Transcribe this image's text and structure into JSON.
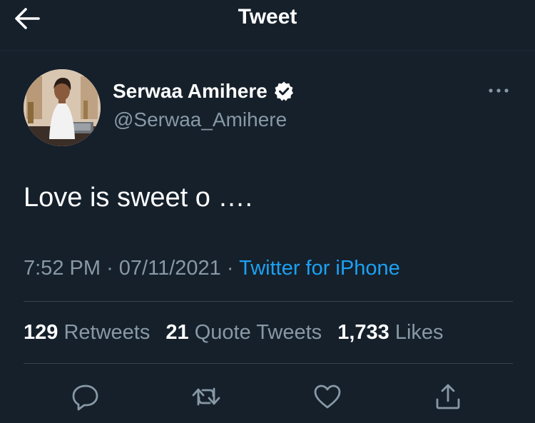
{
  "header": {
    "title": "Tweet",
    "back_icon": "arrow-left-icon"
  },
  "tweet": {
    "display_name": "Serwaa Amihere",
    "handle": "@Serwaa_Amihere",
    "verified": true,
    "text": "Love is sweet o ….",
    "time": "7:52 PM",
    "separator": "·",
    "date": "07/11/2021",
    "source": "Twitter for iPhone"
  },
  "stats": {
    "retweets_count": "129",
    "retweets_label": "Retweets",
    "quotes_count": "21",
    "quotes_label": "Quote Tweets",
    "likes_count": "1,733",
    "likes_label": "Likes"
  },
  "actions": [
    {
      "icon": "reply-icon"
    },
    {
      "icon": "retweet-icon"
    },
    {
      "icon": "like-icon"
    },
    {
      "icon": "share-icon"
    }
  ],
  "colors": {
    "background": "#15202b",
    "text_primary": "#ffffff",
    "text_secondary": "#8899a6",
    "accent": "#1da1f2",
    "divider": "#38444d"
  }
}
